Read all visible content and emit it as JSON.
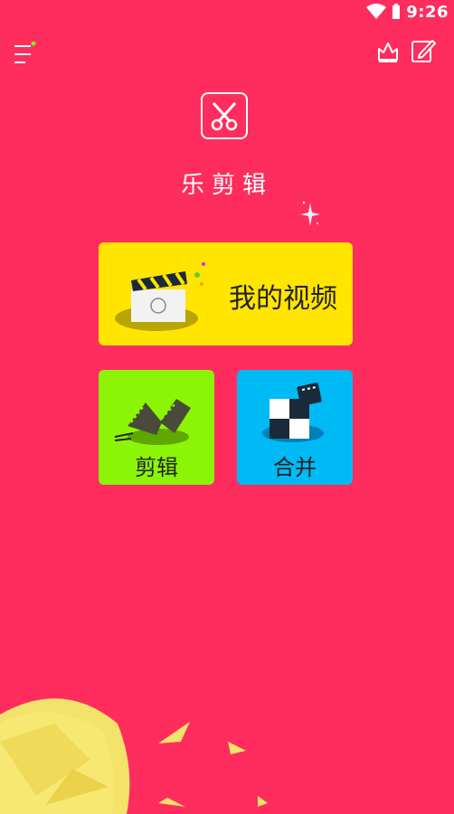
{
  "status_bar": {
    "time": "9:26",
    "wifi_icon": "wifi-icon",
    "battery_icon": "battery-icon"
  },
  "header": {
    "menu_icon": "menu-icon",
    "vip_icon": "crown-icon",
    "edit_icon": "edit-icon"
  },
  "app": {
    "logo_icon": "scissors-logo-icon",
    "title": "乐剪辑"
  },
  "tiles": {
    "my_videos": {
      "label": "我的视频",
      "icon": "clapperboard-icon"
    },
    "edit": {
      "label": "剪辑",
      "icon": "film-cut-icon"
    },
    "merge": {
      "label": "合并",
      "icon": "puzzle-film-icon"
    }
  },
  "colors": {
    "background": "#FF2D5E",
    "my_videos_tile": "#FFE500",
    "edit_tile": "#8CF507",
    "merge_tile": "#00BAF5"
  }
}
